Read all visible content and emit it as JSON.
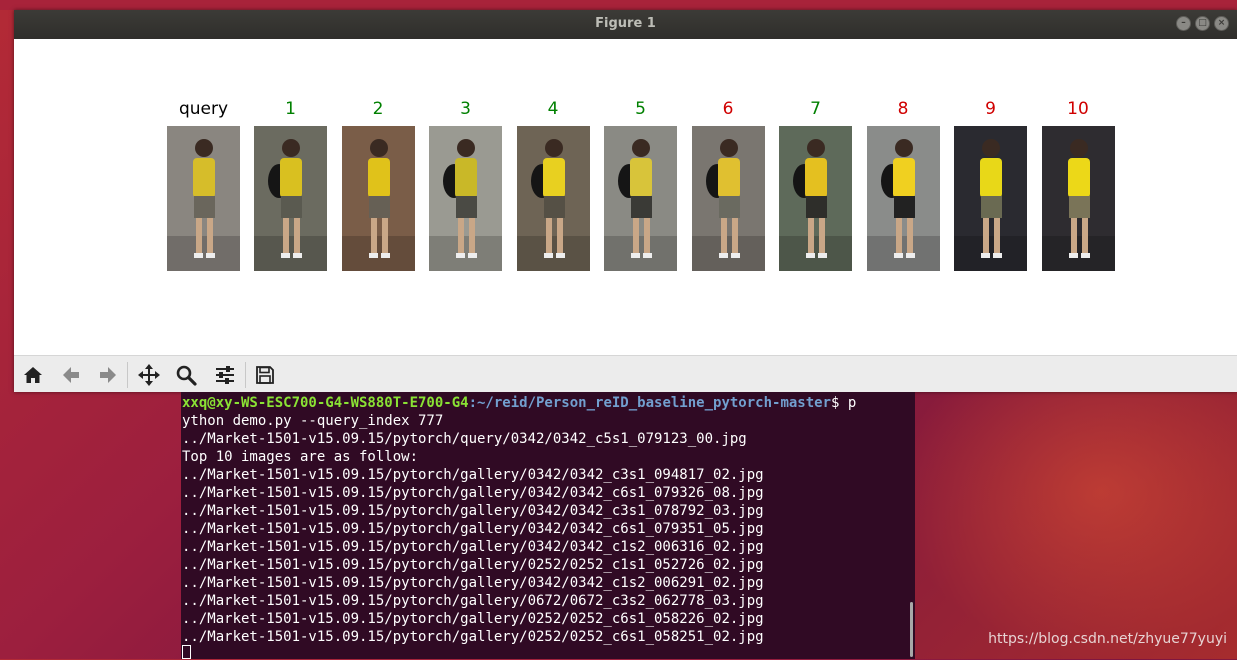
{
  "window": {
    "title": "Figure 1",
    "controls": [
      "minimize",
      "maximize",
      "close"
    ]
  },
  "figure": {
    "query_label": "query",
    "results": [
      {
        "rank": "1",
        "match": true
      },
      {
        "rank": "2",
        "match": true
      },
      {
        "rank": "3",
        "match": true
      },
      {
        "rank": "4",
        "match": true
      },
      {
        "rank": "5",
        "match": true
      },
      {
        "rank": "6",
        "match": false
      },
      {
        "rank": "7",
        "match": true
      },
      {
        "rank": "8",
        "match": false
      },
      {
        "rank": "9",
        "match": false
      },
      {
        "rank": "10",
        "match": false
      }
    ],
    "colors": {
      "match": "#008000",
      "nonmatch": "#d00000",
      "query": "#000000"
    }
  },
  "toolbar": {
    "buttons": [
      "home-icon",
      "back-icon",
      "forward-icon",
      "pan-icon",
      "zoom-icon",
      "configure-subplots-icon",
      "save-icon"
    ]
  },
  "terminal": {
    "prompt_user": "xxq@xy-WS-ESC700-G4-WS880T-E700-G4",
    "prompt_path": ":~/reid/Person_reID_baseline_pytorch-master",
    "prompt_cmd_start": "$ p",
    "lines": [
      "ython demo.py --query_index 777",
      "../Market-1501-v15.09.15/pytorch/query/0342/0342_c5s1_079123_00.jpg",
      "Top 10 images are as follow:",
      "../Market-1501-v15.09.15/pytorch/gallery/0342/0342_c3s1_094817_02.jpg",
      "../Market-1501-v15.09.15/pytorch/gallery/0342/0342_c6s1_079326_08.jpg",
      "../Market-1501-v15.09.15/pytorch/gallery/0342/0342_c3s1_078792_03.jpg",
      "../Market-1501-v15.09.15/pytorch/gallery/0342/0342_c6s1_079351_05.jpg",
      "../Market-1501-v15.09.15/pytorch/gallery/0342/0342_c1s2_006316_02.jpg",
      "../Market-1501-v15.09.15/pytorch/gallery/0252/0252_c1s1_052726_02.jpg",
      "../Market-1501-v15.09.15/pytorch/gallery/0342/0342_c1s2_006291_02.jpg",
      "../Market-1501-v15.09.15/pytorch/gallery/0672/0672_c3s2_062778_03.jpg",
      "../Market-1501-v15.09.15/pytorch/gallery/0252/0252_c6s1_058226_02.jpg",
      "../Market-1501-v15.09.15/pytorch/gallery/0252/0252_c6s1_058251_02.jpg"
    ]
  },
  "watermark": "https://blog.csdn.net/zhyue77yuyi"
}
